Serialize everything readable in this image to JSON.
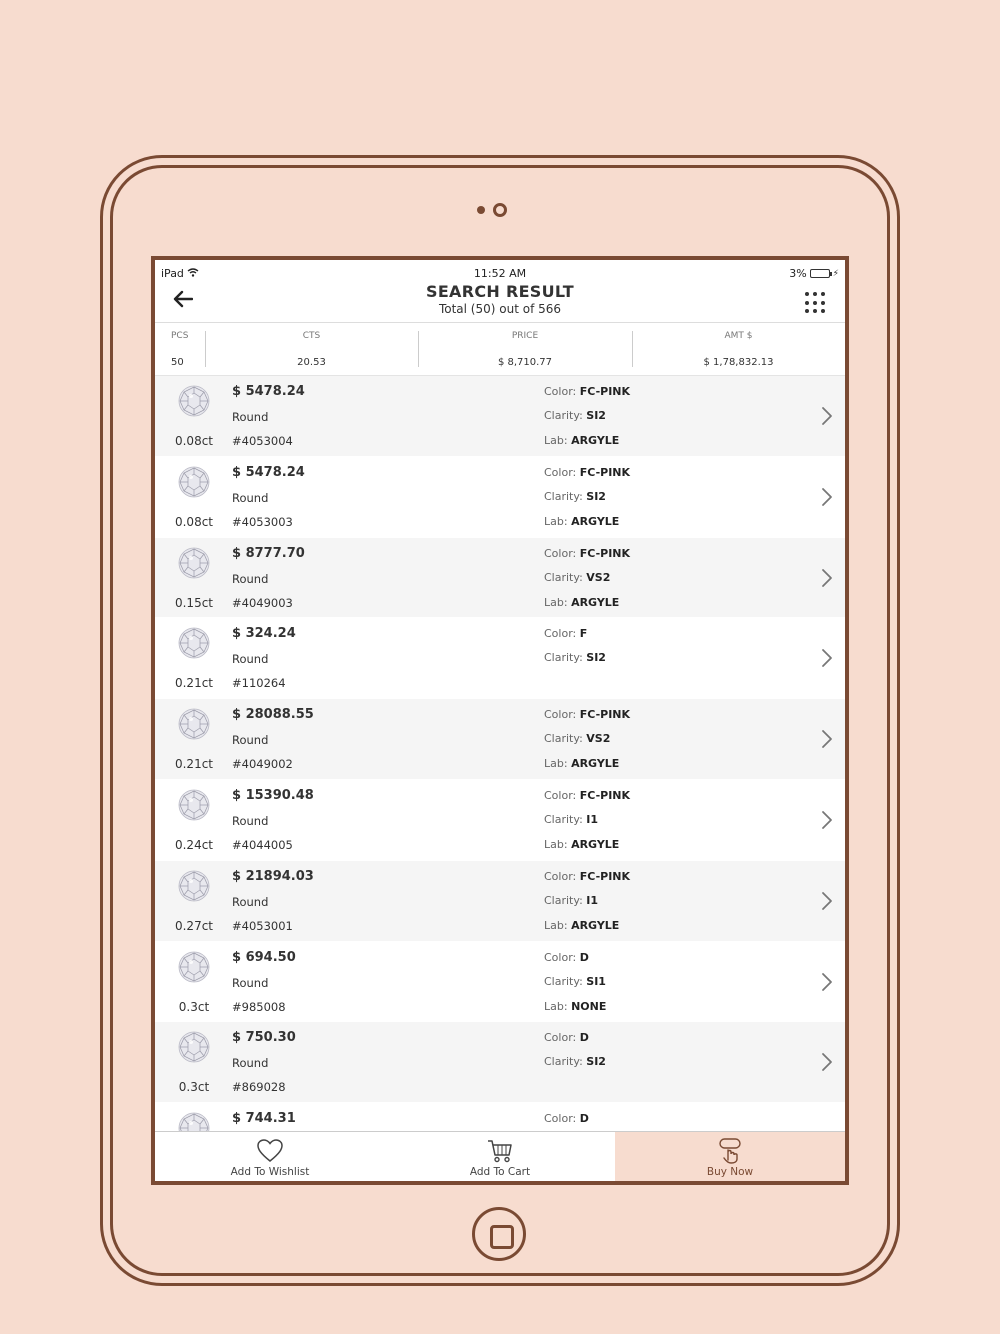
{
  "status_bar": {
    "device": "iPad",
    "time": "11:52 AM",
    "battery": "3%"
  },
  "header": {
    "title": "SEARCH RESULT",
    "subtitle": "Total (50) out of 566"
  },
  "summary": {
    "pcs_label": "PCS",
    "pcs_value": "50",
    "cts_label": "CTS",
    "cts_value": "20.53",
    "price_label": "PRICE",
    "price_value": "$  8,710.77",
    "amt_label": "AMT $",
    "amt_value": "$  1,78,832.13"
  },
  "attr_labels": {
    "color": "Color: ",
    "clarity": "Clarity: ",
    "lab": "Lab: "
  },
  "items": [
    {
      "carat": "0.08ct",
      "price": "$ 5478.24",
      "shape": "Round",
      "stock": "#4053004",
      "color": "FC-PINK",
      "clarity": "SI2",
      "lab": "ARGYLE"
    },
    {
      "carat": "0.08ct",
      "price": "$ 5478.24",
      "shape": "Round",
      "stock": "#4053003",
      "color": "FC-PINK",
      "clarity": "SI2",
      "lab": "ARGYLE"
    },
    {
      "carat": "0.15ct",
      "price": "$ 8777.70",
      "shape": "Round",
      "stock": "#4049003",
      "color": "FC-PINK",
      "clarity": "VS2",
      "lab": "ARGYLE"
    },
    {
      "carat": "0.21ct",
      "price": "$ 324.24",
      "shape": "Round",
      "stock": "#110264",
      "color": "F",
      "clarity": "SI2",
      "lab": ""
    },
    {
      "carat": "0.21ct",
      "price": "$ 28088.55",
      "shape": "Round",
      "stock": "#4049002",
      "color": "FC-PINK",
      "clarity": "VS2",
      "lab": "ARGYLE"
    },
    {
      "carat": "0.24ct",
      "price": "$ 15390.48",
      "shape": "Round",
      "stock": "#4044005",
      "color": "FC-PINK",
      "clarity": "I1",
      "lab": "ARGYLE"
    },
    {
      "carat": "0.27ct",
      "price": "$ 21894.03",
      "shape": "Round",
      "stock": "#4053001",
      "color": "FC-PINK",
      "clarity": "I1",
      "lab": "ARGYLE"
    },
    {
      "carat": "0.3ct",
      "price": "$ 694.50",
      "shape": "Round",
      "stock": "#985008",
      "color": "D",
      "clarity": "SI1",
      "lab": "NONE"
    },
    {
      "carat": "0.3ct",
      "price": "$ 750.30",
      "shape": "Round",
      "stock": "#869028",
      "color": "D",
      "clarity": "SI2",
      "lab": ""
    },
    {
      "carat": "",
      "price": "$ 744.31",
      "shape": "",
      "stock": "",
      "color": "D",
      "clarity": "",
      "lab": ""
    }
  ],
  "tabs": {
    "wishlist": "Add To Wishlist",
    "cart": "Add To Cart",
    "buy": "Buy Now"
  },
  "colors": {
    "brand": "#7a4a33",
    "background": "#f7dccf"
  }
}
